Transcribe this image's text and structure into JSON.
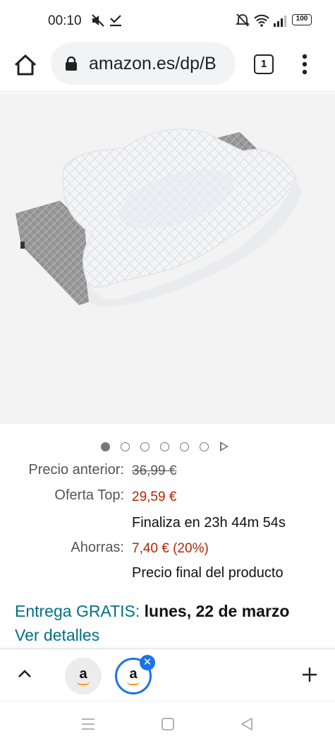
{
  "status_bar": {
    "time": "00:10",
    "battery": "100",
    "icons": [
      "mute-icon",
      "download-done-icon",
      "alarm-off-icon",
      "wifi-icon",
      "signal-icon",
      "battery-icon"
    ]
  },
  "browser": {
    "url": "amazon.es/dp/B",
    "tab_count": "1",
    "icons": [
      "home-icon",
      "lock-icon",
      "more-vert-icon"
    ]
  },
  "carousel": {
    "total_images": 6,
    "active_index": 0
  },
  "price": {
    "previous_label": "Precio anterior:",
    "previous_value": "36,99 €",
    "offer_label": "Oferta Top:",
    "offer_value": "29,59 €",
    "ends_text": "Finaliza en 23h 44m 54s",
    "savings_label": "Ahorras:",
    "savings_value": "7,40 € (20%)",
    "final_note": "Precio final del producto"
  },
  "delivery": {
    "prefix": "Entrega GRATIS:",
    "date": "lunes, 22 de marzo",
    "details_link": "Ver detalles"
  },
  "tabstrip": {
    "tab_letter": "a",
    "close_glyph": "✕"
  },
  "colors": {
    "accent_link": "#007185",
    "price_red": "#b12704",
    "tab_selected": "#1a73e8",
    "amazon_orange": "#ff9900"
  }
}
